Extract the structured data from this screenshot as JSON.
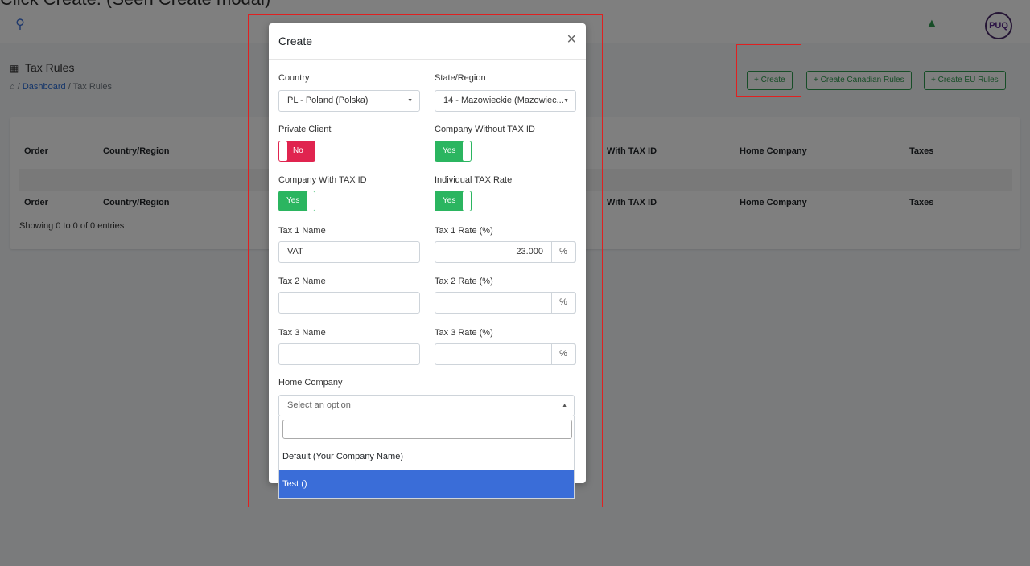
{
  "caption": "Click Create. (Seen Create modal)",
  "header": {
    "avatar_text": "PUQ"
  },
  "page": {
    "title": "Tax Rules",
    "breadcrumb": {
      "dashboard": "Dashboard",
      "separator": "/",
      "current": "Tax Rules"
    }
  },
  "toolbar": {
    "create": "+ Create",
    "create_canadian": "+ Create Canadian Rules",
    "create_eu": "+ Create EU Rules"
  },
  "table": {
    "columns": [
      "Order",
      "Country/Region",
      "With TAX ID",
      "Home Company",
      "Taxes"
    ],
    "status": "Showing 0 to 0 of 0 entries"
  },
  "modal": {
    "title": "Create",
    "close": "×",
    "country": {
      "label": "Country",
      "value": "PL - Poland (Polska)"
    },
    "state": {
      "label": "State/Region",
      "value": "14 - Mazowieckie (Mazowiec..."
    },
    "private_client": {
      "label": "Private Client",
      "value": "No"
    },
    "company_without_tax": {
      "label": "Company Without TAX ID",
      "value": "Yes"
    },
    "company_with_tax": {
      "label": "Company With TAX ID",
      "value": "Yes"
    },
    "individual_tax_rate": {
      "label": "Individual TAX Rate",
      "value": "Yes"
    },
    "tax1_name": {
      "label": "Tax 1 Name",
      "value": "VAT"
    },
    "tax1_rate": {
      "label": "Tax 1 Rate (%)",
      "value": "23.000",
      "suffix": "%"
    },
    "tax2_name": {
      "label": "Tax 2 Name",
      "value": ""
    },
    "tax2_rate": {
      "label": "Tax 2 Rate (%)",
      "value": "",
      "suffix": "%"
    },
    "tax3_name": {
      "label": "Tax 3 Name",
      "value": ""
    },
    "tax3_rate": {
      "label": "Tax 3 Rate (%)",
      "value": "",
      "suffix": "%"
    },
    "home_company": {
      "label": "Home Company",
      "placeholder": "Select an option",
      "options": [
        "Default (Your Company Name)",
        "Test ()"
      ],
      "highlighted": "Test ()"
    }
  },
  "colors": {
    "accent_green": "#2e9a4e",
    "toggle_no": "#e0244f",
    "toggle_yes": "#2bb560",
    "highlight": "#3a6dd8",
    "annotation": "#e02020"
  }
}
